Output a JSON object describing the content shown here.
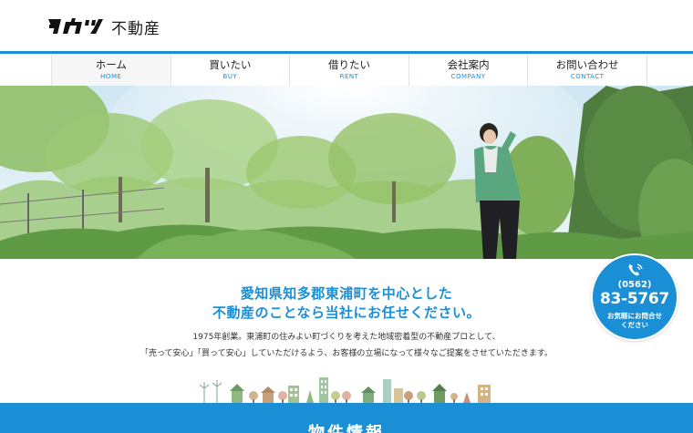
{
  "header": {
    "logo_text": "不動産",
    "logo_name": "タカツ"
  },
  "nav": {
    "items": [
      {
        "jp": "ホーム",
        "en": "HOME",
        "active": true
      },
      {
        "jp": "買いたい",
        "en": "BUY"
      },
      {
        "jp": "借りたい",
        "en": "RENT"
      },
      {
        "jp": "会社案内",
        "en": "COMPANY"
      },
      {
        "jp": "お問い合わせ",
        "en": "CONTACT"
      }
    ]
  },
  "intro": {
    "title_line1": "愛知県知多郡東浦町を中心とした",
    "title_line2": "不動産のことなら当社にお任せください。",
    "body_line1": "1975年創業。東浦町の住みよい町づくりを考えた地域密着型の不動産プロとして、",
    "body_line2": "「売って安心」「買って安心」していただけるよう、お客様の立場になって様々なご提案をさせていただきます。"
  },
  "phone": {
    "area": "(0562)",
    "number": "83-5767",
    "note_line1": "お気軽にお問合せ",
    "note_line2": "ください"
  },
  "band": {
    "title": "物件情報"
  },
  "colors": {
    "accent": "#1b8fd6"
  }
}
